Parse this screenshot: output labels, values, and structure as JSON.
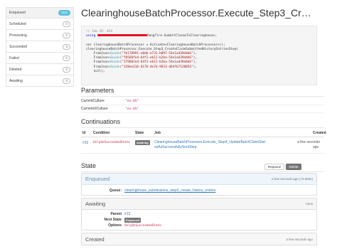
{
  "sidebar": {
    "items": [
      {
        "label": "Enqueued",
        "count": "5/10",
        "active": true,
        "highlight": true
      },
      {
        "label": "Scheduled",
        "count": "0",
        "active": false,
        "highlight": false
      },
      {
        "label": "Processing",
        "count": "0",
        "active": false,
        "highlight": false
      },
      {
        "label": "Succeeded",
        "count": "0",
        "active": false,
        "highlight": false
      },
      {
        "label": "Failed",
        "count": "0",
        "active": false,
        "highlight": false
      },
      {
        "label": "Deleted",
        "count": "0",
        "active": false,
        "highlight": false
      },
      {
        "label": "Awaiting",
        "count": "0",
        "active": false,
        "highlight": false
      }
    ]
  },
  "job": {
    "title": "ClearinghouseBatchProcessor.Execute_Step3_Cr…",
    "code_comment": "// Job ID: #14",
    "code_using_suffix": "Hangfire.SubmitClaimsToClearinghouse;",
    "code_var_line": "var clearinghouseBatchProcessor = Activate<ClearinghouseBatchProcessor>();",
    "code_call_line": "clearinghouseBatchProcessor.Execute_Step3_CreateClaimSubmittedHistoryEntriesStep(",
    "code_guids": [
      "\"7b178991-e0db-e731-b097-54e1ad39d4b6\"",
      "\"f0560fe4-64f1-eb11-b2ba-54e1ad39d4b6\"",
      "\"179601e4-64f1-eb11-b2ba-54e1ad39d4b6\"",
      "\"158ee316-6176-4e7d-9633-d64fb712085d\""
    ],
    "code_null_line": "null);"
  },
  "parameters": {
    "title": "Parameters",
    "rows": [
      {
        "key": "CurrentCulture",
        "value": "\"en-US\""
      },
      {
        "key": "CurrentUICulture",
        "value": "\"en-US\""
      }
    ]
  },
  "continuations": {
    "title": "Continuations",
    "headers": {
      "id": "Id",
      "condition": "Condition",
      "state": "State",
      "job": "Job",
      "created": "Created"
    },
    "rows": [
      {
        "id": "#15",
        "condition": "OnlyOnSucceededState",
        "state": "Awaiting",
        "job_line1": "ClearinghouseBatchProcessor.Execute_Step4_UpdateBatchClaimStat",
        "job_line2": "usAsSuccessfullySentStep",
        "created_line1": "a few seconds",
        "created_line2": "ago"
      }
    ]
  },
  "state": {
    "title": "State",
    "requeue_label": "Requeue",
    "delete_label": "Delete",
    "enqueued": {
      "title": "Enqueued",
      "timestamp": "a few seconds ago (+6.693s)",
      "queue_key": "Queue:",
      "queue_value": "clearinghouse_submissions_step3_create_history_entries"
    },
    "awaiting": {
      "title": "Awaiting",
      "timestamp": "+4ms",
      "parent_key": "Parent",
      "parent_value": "#13",
      "next_state_key": "Next State",
      "next_state_value": "Enqueued",
      "options_key": "Options",
      "options_value": "OnlyOnSucceededState"
    },
    "created": {
      "title": "Created",
      "timestamp": "a few seconds ago"
    }
  }
}
